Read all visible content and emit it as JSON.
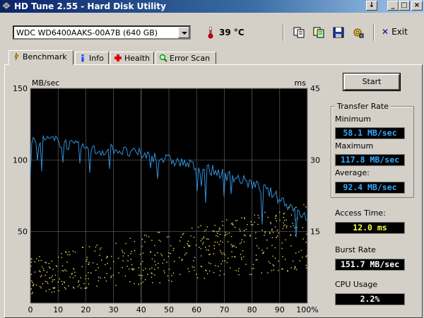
{
  "window": {
    "title": "HD Tune 2.55 - Hard Disk Utility",
    "buttons": {
      "down": "↓",
      "minimize": "_",
      "maximize": "□",
      "close": "×"
    }
  },
  "toolbar": {
    "drive": "WDC WD6400AAKS-00A7B (640 GB)",
    "temperature": "39 °C",
    "exit_label": "Exit"
  },
  "tabs": [
    {
      "label": "Benchmark",
      "icon": "benchmark-icon",
      "active": true
    },
    {
      "label": "Info",
      "icon": "info-icon"
    },
    {
      "label": "Health",
      "icon": "health-icon"
    },
    {
      "label": "Error Scan",
      "icon": "error-scan-icon"
    }
  ],
  "start_label": "Start",
  "transfer_rate": {
    "title": "Transfer Rate",
    "minimum_label": "Minimum",
    "minimum": "58.1 MB/sec",
    "maximum_label": "Maximum",
    "maximum": "117.8 MB/sec",
    "average_label": "Average:",
    "average": "92.4 MB/sec"
  },
  "access_time": {
    "label": "Access Time:",
    "value": "12.0 ms"
  },
  "burst_rate": {
    "label": "Burst Rate",
    "value": "151.7 MB/sec"
  },
  "cpu_usage": {
    "label": "CPU Usage",
    "value": "2.2%"
  },
  "colors": {
    "transfer_line": "#2f8fd8",
    "access_dots": "#e8e060",
    "plot_bg": "#000000",
    "grid": "#606060"
  },
  "chart_data": {
    "type": "line",
    "left_unit": "MB/sec",
    "right_unit": "ms",
    "left_ylim": [
      0,
      150
    ],
    "right_ylim": [
      0,
      45
    ],
    "left_ticks": [
      "50",
      "100",
      "150"
    ],
    "right_ticks": [
      "15",
      "30",
      "45"
    ],
    "x_ticks": [
      "0",
      "10",
      "20",
      "30",
      "40",
      "50",
      "60",
      "70",
      "80",
      "90",
      "100%"
    ],
    "grid": true,
    "series": [
      {
        "kind": "transfer-rate",
        "x": [
          0,
          5,
          10,
          15,
          20,
          25,
          30,
          35,
          40,
          45,
          50,
          55,
          60,
          65,
          70,
          75,
          80,
          85,
          90,
          95,
          100
        ],
        "y": [
          112,
          114,
          113,
          110,
          108,
          106,
          108,
          105,
          104,
          102,
          100,
          98,
          95,
          93,
          90,
          87,
          83,
          79,
          73,
          66,
          60
        ]
      },
      {
        "kind": "access-time",
        "x_range": [
          0,
          100
        ],
        "y_range_ms": [
          2,
          21
        ]
      }
    ]
  }
}
